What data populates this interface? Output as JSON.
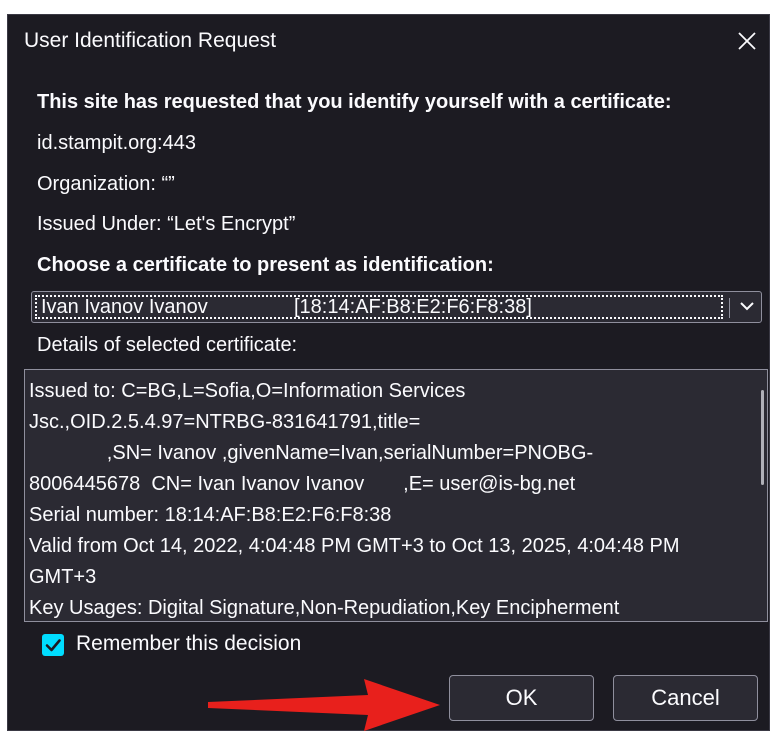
{
  "dialog": {
    "title": "User Identification Request",
    "close_icon": "close-icon"
  },
  "request": {
    "heading": "This site has requested that you identify yourself with a certificate:",
    "host": "id.stampit.org:443",
    "organization": "Organization: “”",
    "issued_under": "Issued Under: “Let's Encrypt”"
  },
  "choose": {
    "heading": "Choose a certificate to present as identification:",
    "selected_name": "Ivan Ivanov Ivanov",
    "selected_fingerprint": "[18:14:AF:B8:E2:F6:F8:38]",
    "dropdown_icon": "chevron-down-icon"
  },
  "details": {
    "label": "Details of selected certificate:",
    "lines": [
      "Issued to: C=BG,L=Sofia,O=Information Services",
      "Jsc.,OID.2.5.4.97=NTRBG-831641791,title=",
      "              ,SN= Ivanov ,givenName=Ivan,serialNumber=PNOBG-",
      "8006445678  CN= Ivan Ivanov Ivanov       ,E= user@is-bg.net",
      "Serial number: 18:14:AF:B8:E2:F6:F8:38",
      "Valid from Oct 14, 2022, 4:04:48 PM GMT+3 to Oct 13, 2025, 4:04:48 PM",
      "GMT+3",
      "Key Usages: Digital Signature,Non-Repudiation,Key Encipherment"
    ]
  },
  "remember": {
    "label": "Remember this decision",
    "checked": true
  },
  "buttons": {
    "ok": "OK",
    "cancel": "Cancel"
  },
  "colors": {
    "background": "#1c1b22",
    "field": "#2b2a33",
    "text": "#fbfbfe",
    "accent": "#00ddff",
    "annotation_arrow": "#e8201c"
  }
}
